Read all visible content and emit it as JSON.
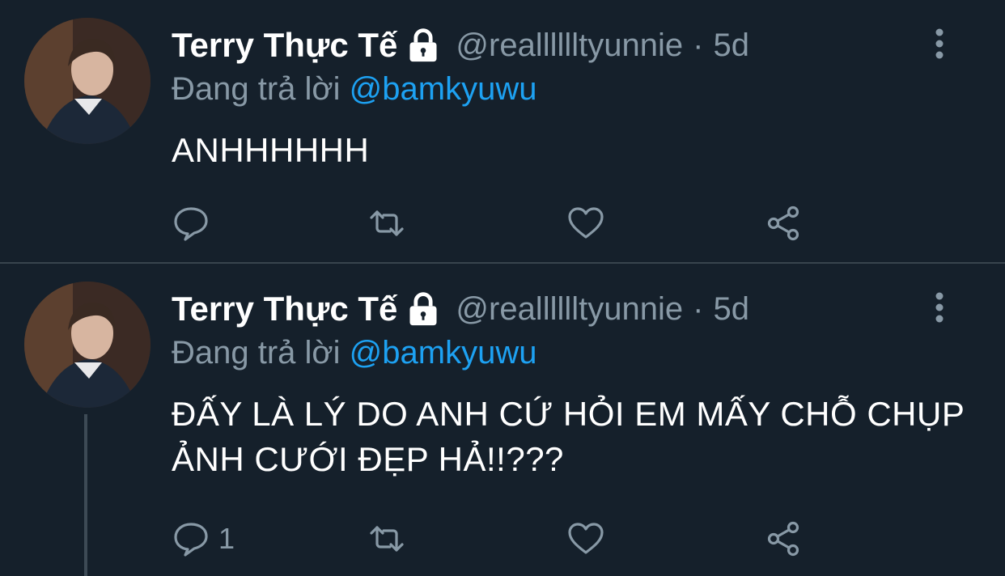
{
  "colors": {
    "background": "#15202b",
    "muted": "#8899a6",
    "accent": "#1da1f2",
    "divider": "#38444d"
  },
  "tweets": [
    {
      "name": "Terry Thực Tế",
      "handle": "@realllllltyunnie",
      "dot": "·",
      "time": "5d",
      "reply_prefix": "Đang trả lời",
      "reply_to": "@bamkyuwu",
      "text": "ANHHHHHH",
      "reply_count": "",
      "icons": [
        "avatar",
        "lock-icon",
        "more-vertical-icon",
        "reply-icon",
        "retweet-icon",
        "like-icon",
        "share-icon"
      ]
    },
    {
      "name": "Terry Thực Tế",
      "handle": "@realllllltyunnie",
      "dot": "·",
      "time": "5d",
      "reply_prefix": "Đang trả lời",
      "reply_to": "@bamkyuwu",
      "text": "ĐẤY LÀ LÝ DO ANH CỨ HỎI EM MẤY CHỖ CHỤP ẢNH CƯỚI ĐẸP HẢ!!???",
      "reply_count": "1",
      "icons": [
        "avatar",
        "lock-icon",
        "more-vertical-icon",
        "reply-icon",
        "retweet-icon",
        "like-icon",
        "share-icon"
      ]
    }
  ]
}
